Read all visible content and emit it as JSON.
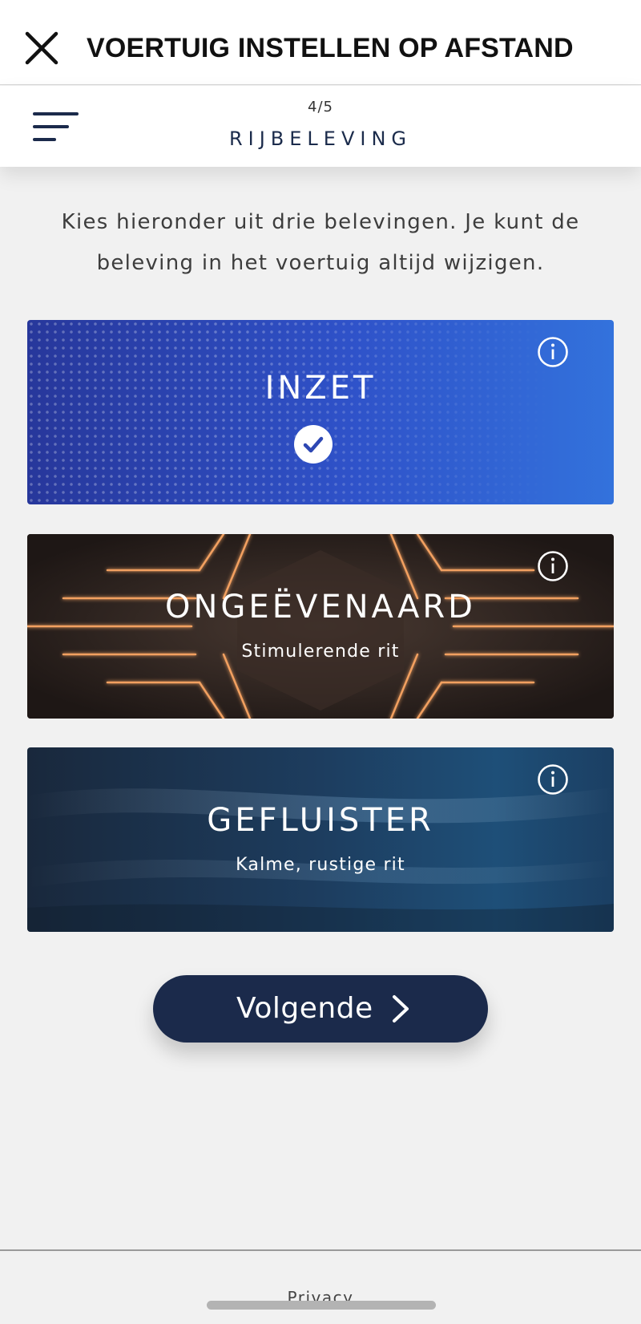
{
  "header": {
    "title": "VOERTUIG INSTELLEN OP AFSTAND",
    "close_icon": "close-icon"
  },
  "stepbar": {
    "menu_icon": "menu-icon",
    "step": "4/5",
    "title": "RIJBELEVING"
  },
  "intro_text": "Kies hieronder uit drie belevingen. Je kunt de beleving in het voertuig altijd wijzigen.",
  "experiences": [
    {
      "title": "INZET",
      "subtitle": "",
      "selected": true,
      "info_icon": "info-icon",
      "color": "#2f52c9"
    },
    {
      "title": "ONGEËVENAARD",
      "subtitle": "Stimulerende rit",
      "selected": false,
      "info_icon": "info-icon",
      "color": "#2b211e"
    },
    {
      "title": "GEFLUISTER",
      "subtitle": "Kalme, rustige rit",
      "selected": false,
      "info_icon": "info-icon",
      "color": "#1d3d5f"
    }
  ],
  "next_button": {
    "label": "Volgende",
    "icon": "chevron-right-icon",
    "color": "#1b2a4b"
  },
  "footer": {
    "privacy_label": "Privacy"
  }
}
